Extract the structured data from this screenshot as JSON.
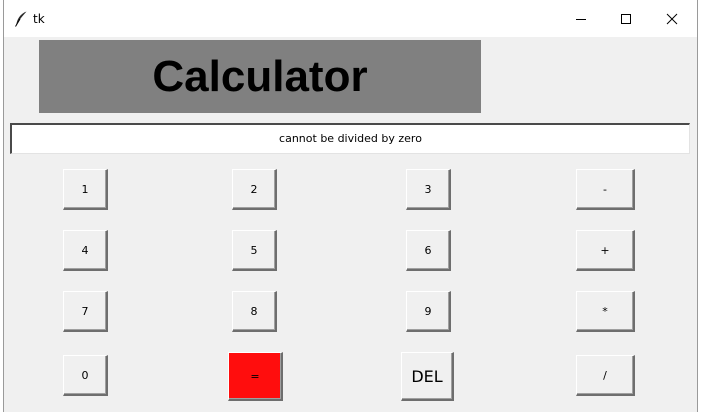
{
  "window": {
    "title": "tk",
    "icons": {
      "app": "feather-icon",
      "minimize": "minimize-icon",
      "maximize": "maximize-icon",
      "close": "close-icon"
    }
  },
  "heading": {
    "text": "Calculator",
    "background": "#808080"
  },
  "display": {
    "value": "cannot be divided by zero"
  },
  "keypad": {
    "row1": [
      "1",
      "2",
      "3",
      "-"
    ],
    "row2": [
      "4",
      "5",
      "6",
      "+"
    ],
    "row3": [
      "7",
      "8",
      "9",
      "*"
    ],
    "row4": [
      "0",
      "=",
      "DEL",
      "/"
    ],
    "equals_color": "#ff0d0d"
  }
}
